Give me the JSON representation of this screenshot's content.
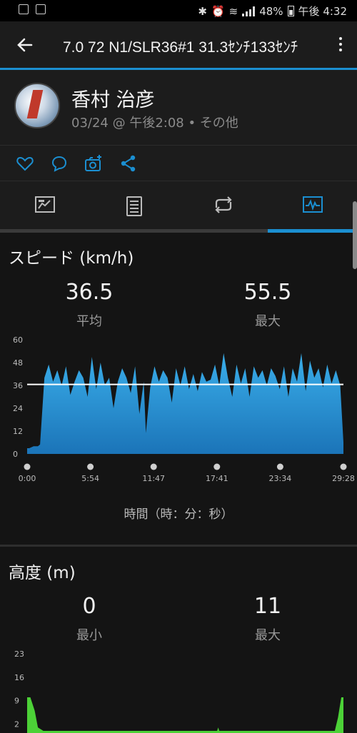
{
  "status_bar": {
    "battery": "48%",
    "time": "午後 4:32"
  },
  "app_bar": {
    "title": "7.0 72 N1/SLR36#1 31.3ｾﾝﾁ133ｾﾝﾁ"
  },
  "profile": {
    "name": "香村 治彦",
    "meta": "03/24 @ 午後2:08 • その他"
  },
  "actions": [
    "heart-icon",
    "comment-icon",
    "camera-add-icon",
    "share-icon"
  ],
  "tabs": [
    "summary-chart-icon",
    "document-icon",
    "loop-icon",
    "activity-chart-icon"
  ],
  "speed": {
    "title": "スピード (km/h)",
    "avg_value": "36.5",
    "avg_label": "平均",
    "max_value": "55.5",
    "max_label": "最大",
    "axis_caption": "時間（時：分：秒）"
  },
  "altitude": {
    "title": "高度 (m)",
    "min_value": "0",
    "min_label": "最小",
    "max_value": "11",
    "max_label": "最大"
  },
  "colors": {
    "accent": "#1b8fd1",
    "speed_fill": "#2f9be0",
    "altitude_fill": "#4cd137"
  },
  "chart_data": [
    {
      "type": "area",
      "ylabel": "スピード (km/h)",
      "xlabel": "時間（時：分：秒）",
      "ylim": [
        0,
        60
      ],
      "y_ticks": [
        "0",
        "12",
        "24",
        "36",
        "48",
        "60"
      ],
      "x_tick_labels": [
        "0:00",
        "5:54",
        "11:47",
        "17:41",
        "23:34",
        "29:28"
      ],
      "average_line": 36.5,
      "series": [
        {
          "x": [
            0,
            0.2,
            0.6,
            1.0,
            1.2,
            1.6,
            2.0,
            2.4,
            2.8,
            3.2,
            3.6,
            4.0,
            4.4,
            4.8,
            5.2,
            5.6,
            6.0,
            6.4,
            6.8,
            7.2,
            7.6,
            8.0,
            8.4,
            8.8,
            9.2,
            9.6,
            10.0,
            10.4,
            10.8,
            11.0,
            11.4,
            11.8,
            12.2,
            12.6,
            13.0,
            13.4,
            13.8,
            14.2,
            14.6,
            15.0,
            15.4,
            15.8,
            16.2,
            16.6,
            17.0,
            17.4,
            17.8,
            18.2,
            18.6,
            19.0,
            19.4,
            19.8,
            20.2,
            20.6,
            21.0,
            21.4,
            21.8,
            22.2,
            22.6,
            23.0,
            23.4,
            23.8,
            24.2,
            24.6,
            25.0,
            25.4,
            25.8,
            26.2,
            26.6,
            27.0,
            27.4,
            27.8,
            28.2,
            28.6,
            29.0,
            29.3
          ],
          "values": [
            3,
            3,
            4,
            4,
            5,
            40,
            47,
            38,
            44,
            36,
            46,
            31,
            38,
            44,
            40,
            30,
            51,
            34,
            48,
            36,
            40,
            24,
            38,
            45,
            40,
            32,
            46,
            21,
            38,
            11,
            35,
            46,
            38,
            44,
            40,
            27,
            45,
            36,
            46,
            34,
            42,
            33,
            43,
            38,
            39,
            47,
            36,
            53,
            40,
            30,
            47,
            37,
            45,
            30,
            46,
            40,
            44,
            36,
            45,
            41,
            34,
            46,
            30,
            45,
            38,
            53,
            33,
            49,
            40,
            45,
            35,
            47,
            37,
            44,
            36,
            6
          ]
        }
      ]
    },
    {
      "type": "area",
      "ylabel": "高度 (m)",
      "ylim": [
        0,
        23
      ],
      "y_ticks": [
        "2",
        "9",
        "16",
        "23"
      ],
      "series": [
        {
          "x": [
            0,
            0.3,
            0.7,
            1.0,
            1.5,
            2.0,
            5,
            10,
            15,
            17.6,
            17.7,
            17.8,
            20,
            25,
            28.5,
            28.8,
            29.1,
            29.3
          ],
          "values": [
            10,
            10,
            6,
            1,
            0,
            0,
            0,
            0,
            0,
            0,
            1,
            0,
            0,
            0,
            0,
            4,
            10,
            10
          ]
        }
      ]
    }
  ]
}
